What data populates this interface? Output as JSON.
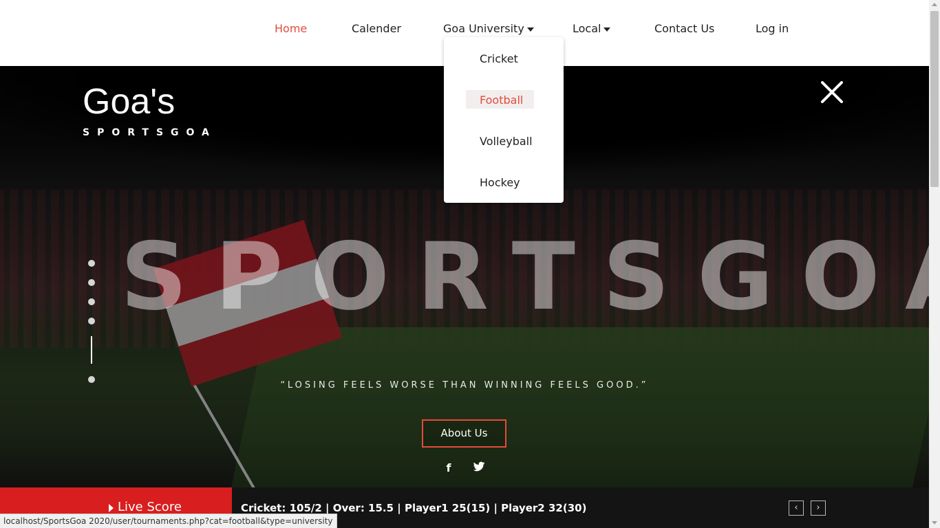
{
  "nav": {
    "items": [
      {
        "label": "Home",
        "active": true
      },
      {
        "label": "Calender"
      },
      {
        "label": "Goa University",
        "dropdown": true
      },
      {
        "label": "Local",
        "dropdown": true
      },
      {
        "label": "Contact Us"
      },
      {
        "label": "Log in"
      }
    ]
  },
  "dropdown": {
    "items": [
      {
        "label": "Cricket"
      },
      {
        "label": "Football",
        "active": true
      },
      {
        "label": "Volleyball"
      },
      {
        "label": "Hockey"
      }
    ]
  },
  "hero": {
    "brand_title": "Goa's",
    "brand_subtitle": "SPORTSGOA",
    "watermark": "SPORTSGOA",
    "quote": "“LOSING FEELS WORSE THAN WINNING FEELS GOOD.”",
    "about_button": "About Us",
    "slider_dots": 5
  },
  "social": {
    "facebook_glyph": "f",
    "twitter_glyph": "🐦"
  },
  "live": {
    "label": "Live Score",
    "score": "Cricket: 105/2 | Over: 15.5 | Player1 25(15) | Player2 32(30)",
    "prev": "‹",
    "next": "›"
  },
  "status_url": "localhost/SportsGoa 2020/user/tournaments.php?cat=football&type=university",
  "colors": {
    "accent": "#e44b3a",
    "live_red": "#d81e1e",
    "bar_dark": "#141414"
  }
}
